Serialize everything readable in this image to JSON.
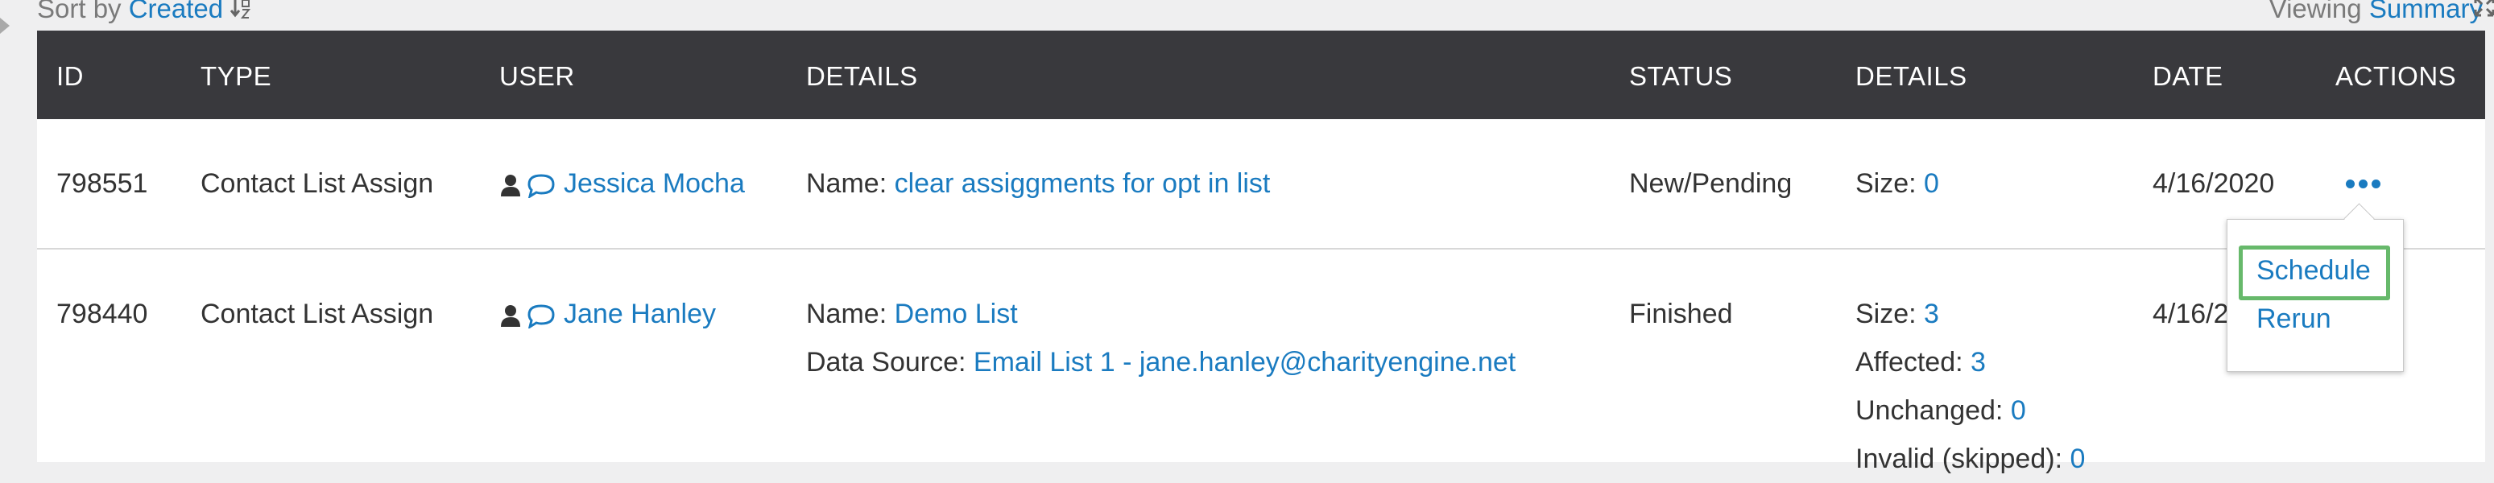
{
  "toolbar": {
    "sort_prefix": "Sort by",
    "sort_value": "Created",
    "viewing_prefix": "Viewing",
    "viewing_value": "Summary"
  },
  "table": {
    "headers": [
      "ID",
      "TYPE",
      "USER",
      "DETAILS",
      "STATUS",
      "DETAILS",
      "DATE",
      "ACTIONS"
    ],
    "rows": [
      {
        "id": "798551",
        "type": "Contact List Assign",
        "user": "Jessica Mocha",
        "details_label": "Name:",
        "details_value": "clear assiggments for opt in list",
        "status": "New/Pending",
        "size_label": "Size:",
        "size_value": "0",
        "date": "4/16/2020"
      },
      {
        "id": "798440",
        "type": "Contact List Assign",
        "user": "Jane Hanley",
        "details_label": "Name:",
        "details_value": "Demo List",
        "data_source_label": "Data Source:",
        "data_source_value": "Email List 1 - jane.hanley@charityengine.net",
        "status": "Finished",
        "size_label": "Size:",
        "size_value": "3",
        "affected_label": "Affected:",
        "affected_value": "3",
        "unchanged_label": "Unchanged:",
        "unchanged_value": "0",
        "invalid_label": "Invalid (skipped):",
        "invalid_value": "0",
        "date": "4/16/2"
      }
    ]
  },
  "dropdown": {
    "items": [
      "Schedule",
      "Rerun"
    ]
  },
  "colors": {
    "header_bg": "#39393d",
    "link": "#1a7bc0",
    "highlight": "#67b96b"
  },
  "icons": [
    "sort-icon",
    "expand-icon",
    "user-icon",
    "chat-icon",
    "more-icon"
  ]
}
